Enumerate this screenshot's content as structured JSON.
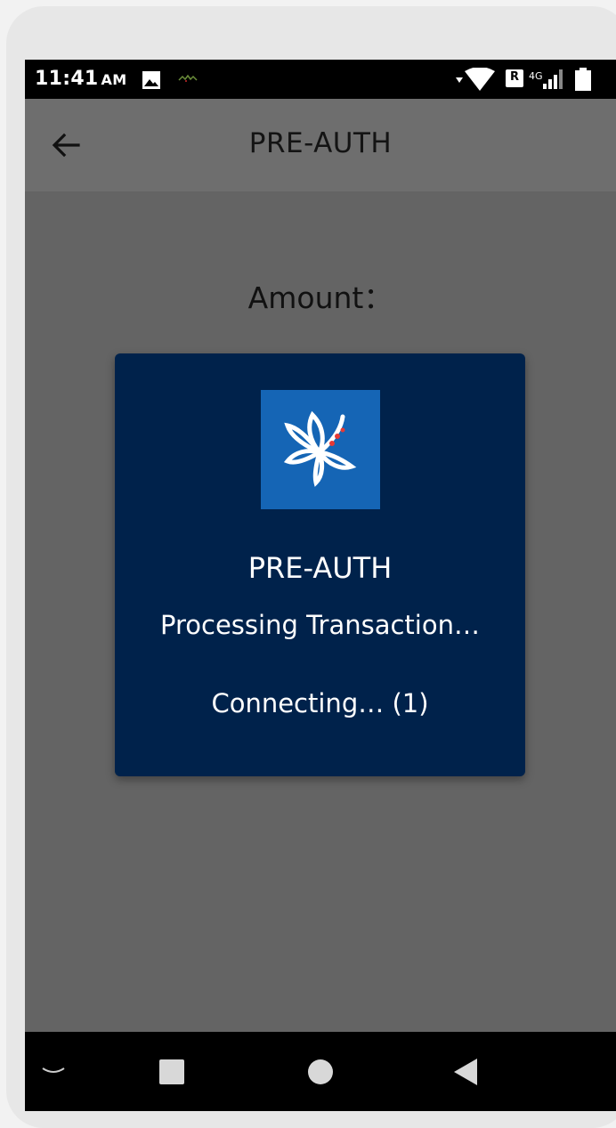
{
  "status_bar": {
    "time": "11:41",
    "ampm": "AM",
    "sim_badge": "R",
    "network_type": "4G"
  },
  "app_bar": {
    "title": "PRE-AUTH"
  },
  "content": {
    "amount_label": "Amount："
  },
  "dialog": {
    "title": "PRE-AUTH",
    "status": "Processing Transaction…",
    "progress": "Connecting… (1)"
  },
  "colors": {
    "dialog_bg": "#00224b",
    "logo_bg": "#1565b5",
    "logo_accent": "#e53935",
    "screen_overlay": "#646464"
  },
  "icons": {
    "back": "arrow-left-icon",
    "gallery": "image-icon",
    "wifi": "wifi-icon",
    "signal": "signal-icon",
    "battery": "battery-icon",
    "nav_recents": "square-icon",
    "nav_home": "circle-icon",
    "nav_back": "triangle-back-icon",
    "nav_keyboard": "chevron-down-icon"
  }
}
